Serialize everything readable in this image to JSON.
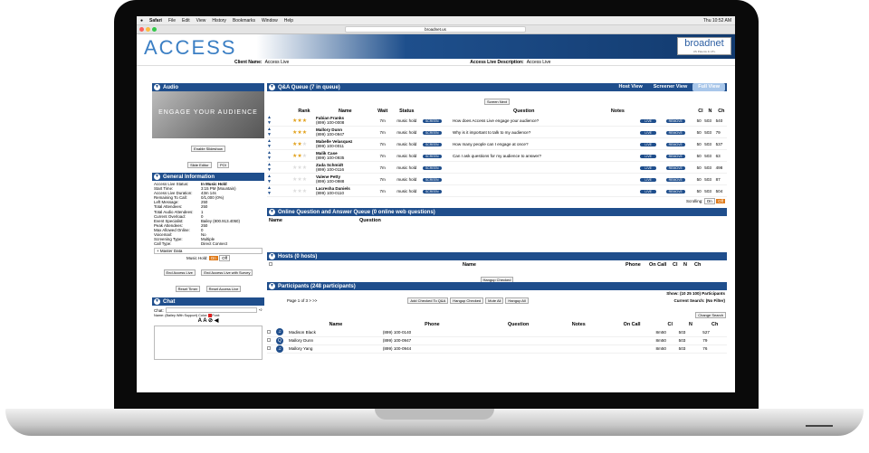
{
  "browser": {
    "menus": [
      "Safari",
      "File",
      "Edit",
      "View",
      "History",
      "Bookmarks",
      "Window",
      "Help"
    ],
    "clock": "Thu 10:52 AM",
    "url": "broadnet.us"
  },
  "brand": {
    "logo": "ACCESS",
    "broadnet": "broadnet",
    "broadnet_tag": "US Patents & UTL"
  },
  "client": {
    "name_label": "Client Name:",
    "name": "Access Live",
    "desc_label": "Access Live Description:",
    "desc": "Access Live"
  },
  "audio": {
    "title": "Audio",
    "image_text": "ENGAGE YOUR AUDIENCE",
    "enable_slideshow": "Enable Slideshow",
    "slide_editor": "Slide Editor",
    "poi": "POI"
  },
  "general": {
    "title": "General Information",
    "rows": [
      [
        "Access Live Status:",
        "In Music Hold"
      ],
      [
        "Start Time:",
        "3:15 PM (Mountain)"
      ],
      [
        "Access Live Duration:",
        "43m 14s"
      ],
      [
        "Remaining To Call:",
        "0/1,000 (0%)"
      ],
      [
        "Left Message:",
        "250"
      ],
      [
        "Total Attendees:",
        "250"
      ],
      [
        "Total Audio Attendees:",
        "1"
      ],
      [
        "Current Overload:",
        "0"
      ],
      [
        "Event Specialist:",
        "Bailey (800.913.4050)"
      ],
      [
        "Peak Attendees:",
        "250"
      ],
      [
        "Max Allowed Online:",
        "0"
      ],
      [
        "Voicemail:",
        "No"
      ],
      [
        "Screening Type:",
        "Multiple"
      ],
      [
        "Call Type:",
        "Direct Connect"
      ]
    ],
    "master_data": "Master Data",
    "music_hold": "Music Hold:",
    "on": "On",
    "off": "Off",
    "end_btn": "End Access Live",
    "end_survey_btn": "End Access Live with Survey",
    "reset_timer": "Reset Timer",
    "reset_live": "Reset Access Live"
  },
  "chat": {
    "title": "Chat",
    "label": "Chat:",
    "name_line": "Name: (Bailey With Support)  Color:",
    "font": "Font:",
    "font_sizes": "A A"
  },
  "qa": {
    "title": "Q&A Queue (7 in queue)",
    "views": [
      "Host View",
      "Screener View",
      "Full View"
    ],
    "screen_next": "Screen Next",
    "headers": [
      "Rank",
      "Name",
      "Wait",
      "Status",
      "Question",
      "Notes",
      "Cl",
      "N",
      "Ch"
    ],
    "rows": [
      {
        "stars": 3,
        "name": "Fabian Franks",
        "phone": "(899) 100-0008",
        "wait": "7m",
        "status": "music hold",
        "q": "How does Access Live engage your audience?",
        "cl": "50",
        "n": "503",
        "ch": "540"
      },
      {
        "stars": 3,
        "name": "Mallory Dunn",
        "phone": "(899) 100-0947",
        "wait": "7m",
        "status": "music hold",
        "q": "Why is it important to talk to my audience?",
        "cl": "50",
        "n": "503",
        "ch": "79"
      },
      {
        "stars": 2,
        "name": "Mabelle Velasquez",
        "phone": "(899) 100-0011",
        "wait": "7m",
        "status": "music hold",
        "q": "How many people can I engage at once?",
        "cl": "50",
        "n": "503",
        "ch": "537"
      },
      {
        "stars": 2,
        "name": "Malik Case",
        "phone": "(899) 100-0935",
        "wait": "7m",
        "status": "music hold",
        "q": "Can I ask questions for my audience to answer?",
        "cl": "50",
        "n": "503",
        "ch": "63"
      },
      {
        "stars": 0,
        "name": "Zada Schmidt",
        "phone": "(899) 100-0116",
        "wait": "7m",
        "status": "music hold",
        "q": "",
        "cl": "50",
        "n": "503",
        "ch": "498"
      },
      {
        "stars": 0,
        "name": "Valene Petty",
        "phone": "(899) 100-0988",
        "wait": "7m",
        "status": "music hold",
        "q": "",
        "cl": "50",
        "n": "503",
        "ch": "87"
      },
      {
        "stars": 0,
        "name": "Lacresha Daniels",
        "phone": "(899) 100-0110",
        "wait": "7m",
        "status": "music hold",
        "q": "",
        "cl": "50",
        "n": "503",
        "ch": "504"
      }
    ],
    "btn_screen": "SCREEN",
    "btn_live": "LIVE",
    "btn_remove": "REMOVE",
    "scrolling": "Scrolling:",
    "on": "On",
    "off": "Off"
  },
  "online": {
    "title": "Online Question and Answer Queue (0 online web questions)",
    "headers": [
      "Name",
      "Question"
    ]
  },
  "hosts": {
    "title": "Hosts (0 hosts)",
    "headers": [
      "Name",
      "Phone",
      "On Call",
      "Cl",
      "N",
      "Ch"
    ],
    "hangup": "Hangup Checked"
  },
  "participants": {
    "title": "Participants (248 participants)",
    "show": "Show: (10 25 100) Participants",
    "search": "Current Search: (No Filter)",
    "change_search": "Change Search",
    "page": "Page 1 of 3  >  >>",
    "buttons": [
      "Add Checked To Q&A",
      "Hangup Checked",
      "Mute All",
      "Hangup All"
    ],
    "headers": [
      "Name",
      "Phone",
      "Question",
      "Notes",
      "On Call",
      "Cl",
      "N",
      "Ch"
    ],
    "rows": [
      {
        "name": "Madison Black",
        "phone": "(899) 100-0140",
        "oncall": "8m",
        "cl": "50",
        "n": "503",
        "ch": "527"
      },
      {
        "name": "Mallory Dunn",
        "phone": "(899) 100-0947",
        "oncall": "8m",
        "cl": "50",
        "n": "503",
        "ch": "79"
      },
      {
        "name": "Mallory Yang",
        "phone": "(899) 100-0944",
        "oncall": "8m",
        "cl": "50",
        "n": "503",
        "ch": "76"
      }
    ]
  }
}
